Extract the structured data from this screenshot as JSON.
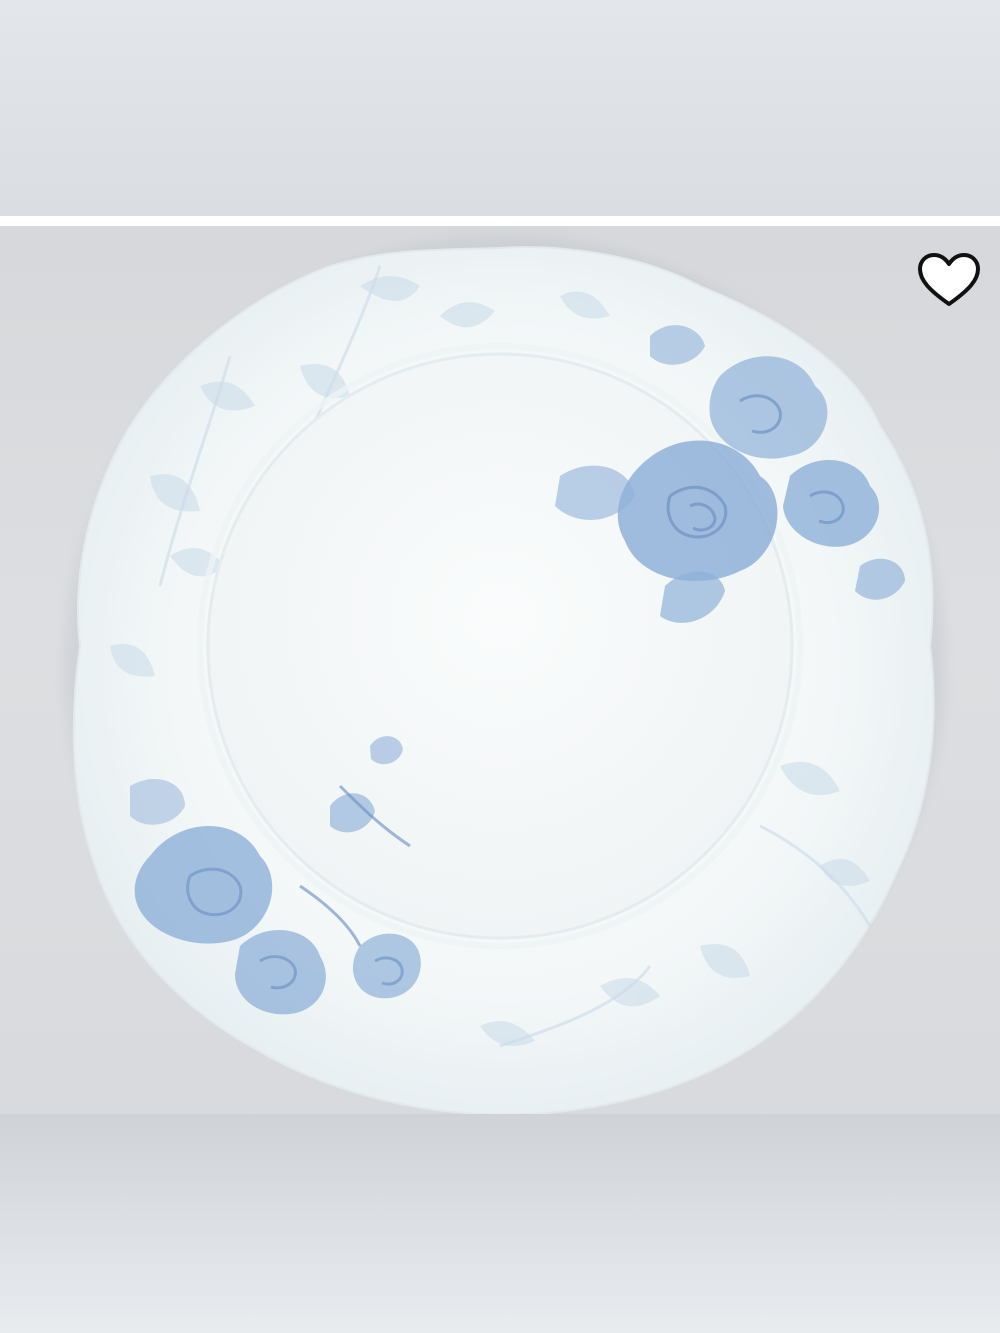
{
  "product_image": {
    "alt": "",
    "colors": {
      "backdrop": "#d8dadd",
      "plate": "#f6fafa",
      "pattern": "#8fb0d8",
      "pattern_light": "#c9dbe9"
    }
  },
  "favorite": {
    "icon": "heart-outline-icon",
    "selected": false
  }
}
